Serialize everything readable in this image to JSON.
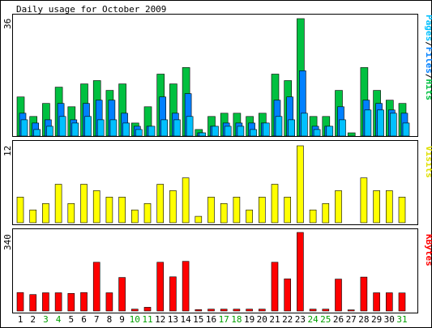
{
  "title": "Daily usage for October 2009",
  "colors": {
    "hits": "#00c040",
    "files": "#0080ff",
    "pages": "#00c0ff",
    "visits": "#ffff00",
    "kbytes": "#ff0000",
    "weekend_label": "#00a000",
    "weekday_label": "#000000",
    "panel_border": "#000000"
  },
  "labels": {
    "top_axis_max": "36",
    "mid_axis_max": "12",
    "bot_axis_max": "340",
    "top_legend_pages": "Pages",
    "top_legend_sep1": "/",
    "top_legend_files": "Files",
    "top_legend_sep2": "/",
    "top_legend_hits": "Hits",
    "mid_legend": "Visits",
    "bot_legend": "KBytes"
  },
  "chart_data": {
    "type": "bar",
    "title": "Daily usage for October 2009",
    "categories": [
      "1",
      "2",
      "3",
      "4",
      "5",
      "6",
      "7",
      "8",
      "9",
      "10",
      "11",
      "12",
      "13",
      "14",
      "15",
      "16",
      "17",
      "18",
      "19",
      "20",
      "21",
      "22",
      "23",
      "24",
      "25",
      "26",
      "27",
      "28",
      "29",
      "30",
      "31"
    ],
    "weekend_days": [
      "3",
      "4",
      "10",
      "11",
      "17",
      "18",
      "24",
      "25",
      "31"
    ],
    "panels": [
      {
        "name": "top",
        "ymax": 36,
        "series": [
          {
            "name": "Hits",
            "values": [
              12,
              6,
              10,
              15,
              9,
              16,
              17,
              14,
              16,
              4,
              9,
              19,
              16,
              21,
              2,
              6,
              7,
              7,
              6,
              7,
              19,
              17,
              36,
              6,
              6,
              14,
              1,
              21,
              14,
              11,
              10
            ]
          },
          {
            "name": "Files",
            "values": [
              7,
              4,
              5,
              10,
              5,
              10,
              11,
              11,
              7,
              3,
              3,
              12,
              7,
              13,
              1,
              3,
              4,
              4,
              4,
              4,
              11,
              12,
              20,
              3,
              3,
              9,
              0,
              11,
              10,
              8,
              7
            ]
          },
          {
            "name": "Pages",
            "values": [
              5,
              2,
              3,
              6,
              4,
              6,
              5,
              5,
              4,
              2,
              3,
              5,
              5,
              6,
              1,
              3,
              3,
              3,
              2,
              4,
              6,
              5,
              7,
              2,
              3,
              5,
              0,
              8,
              8,
              7,
              4
            ]
          }
        ]
      },
      {
        "name": "middle",
        "ymax": 12,
        "series": [
          {
            "name": "Visits",
            "values": [
              4,
              2,
              3,
              6,
              3,
              6,
              5,
              4,
              4,
              2,
              3,
              6,
              5,
              7,
              1,
              4,
              3,
              4,
              2,
              4,
              6,
              4,
              12,
              2,
              3,
              5,
              0,
              7,
              5,
              5,
              4
            ]
          }
        ]
      },
      {
        "name": "bottom",
        "ymax": 340,
        "series": [
          {
            "name": "KBytes",
            "values": [
              80,
              71,
              79,
              79,
              76,
              80,
              211,
              79,
              145,
              8,
              16,
              211,
              148,
              215,
              6,
              8,
              8,
              8,
              8,
              8,
              211,
              139,
              340,
              8,
              8,
              138,
              5,
              147,
              79,
              79,
              78
            ]
          }
        ]
      }
    ]
  }
}
